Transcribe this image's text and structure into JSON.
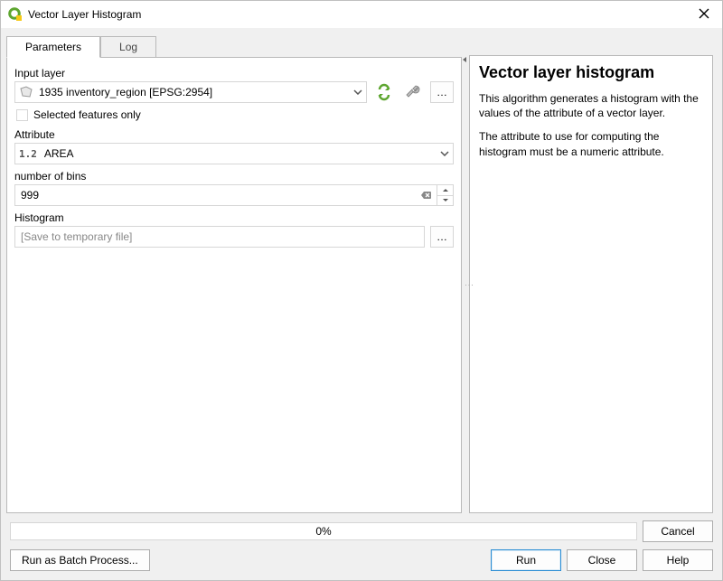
{
  "window": {
    "title": "Vector Layer Histogram"
  },
  "tabs": {
    "parameters": "Parameters",
    "log": "Log"
  },
  "labels": {
    "input_layer": "Input layer",
    "selected_only": "Selected features only",
    "attribute": "Attribute",
    "bins": "number of bins",
    "histogram": "Histogram"
  },
  "values": {
    "input_layer": "1935 inventory_region [EPSG:2954]",
    "attribute_prefix": "1.2",
    "attribute": "AREA",
    "bins": "999",
    "output_placeholder": "[Save to temporary file]"
  },
  "help": {
    "title": "Vector layer histogram",
    "p1": "This algorithm generates a histogram with the values of the attribute of a vector layer.",
    "p2": "The attribute to use for computing the histogram must be a numeric attribute."
  },
  "progress": {
    "text": "0%"
  },
  "buttons": {
    "cancel": "Cancel",
    "batch": "Run as Batch Process...",
    "run": "Run",
    "close": "Close",
    "help": "Help"
  }
}
